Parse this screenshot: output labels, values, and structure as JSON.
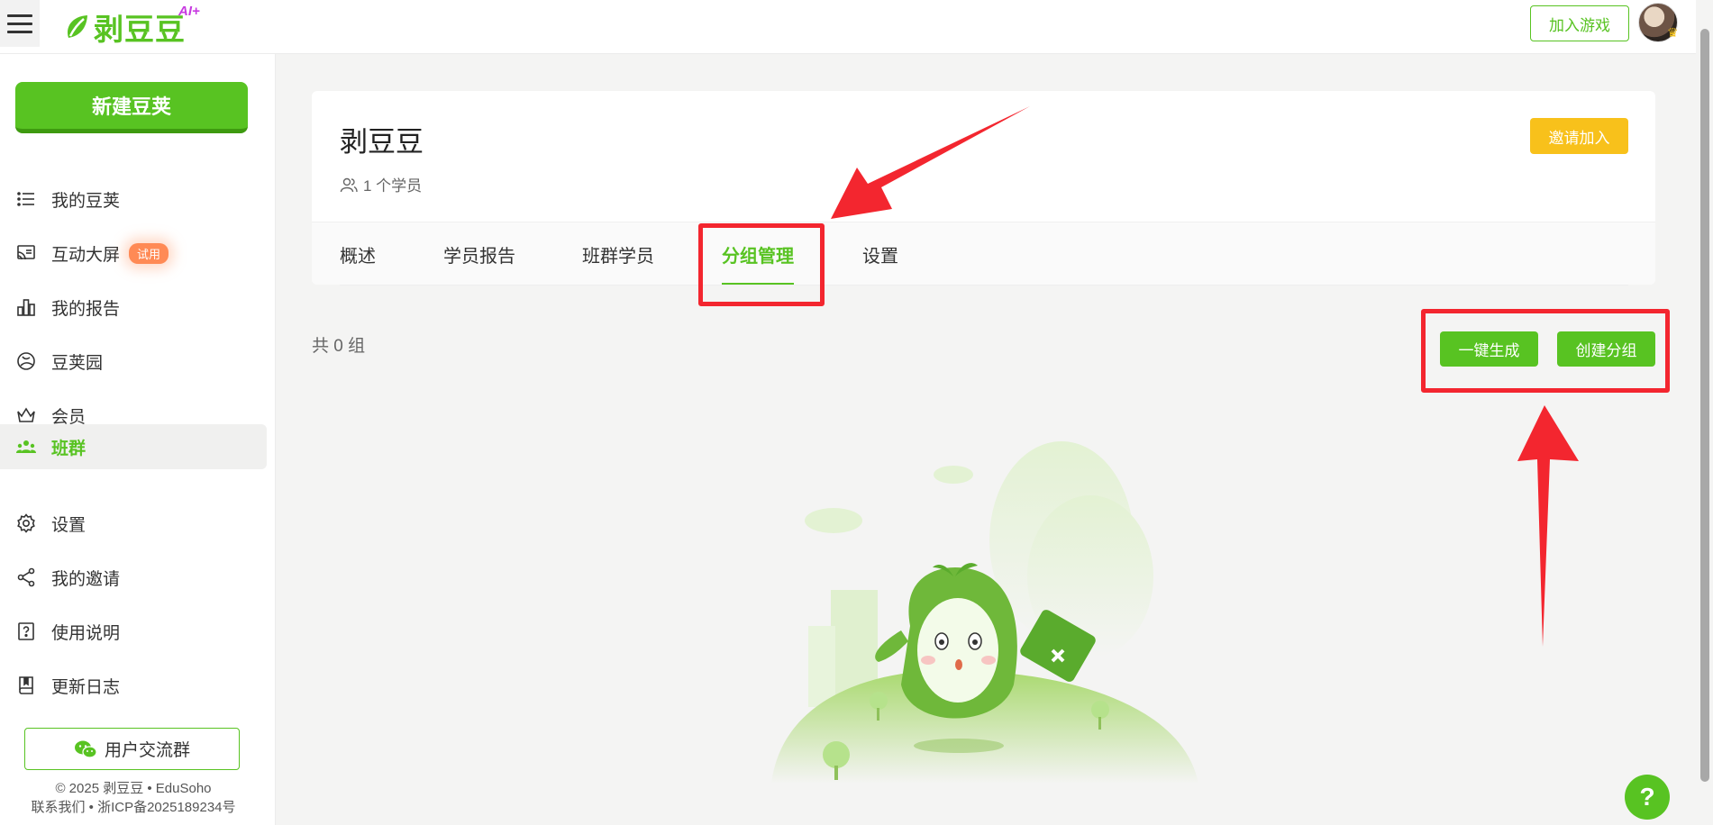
{
  "header": {
    "logo_text": "剥豆豆",
    "logo_badge": "AI+",
    "join_game_label": "加入游戏",
    "brand_color": "#58c322"
  },
  "sidebar": {
    "new_button_label": "新建豆荚",
    "items": [
      {
        "label": "我的豆荚",
        "icon": "list-icon",
        "active": false
      },
      {
        "label": "互动大屏",
        "icon": "cast-screen-icon",
        "badge": "试用",
        "active": false
      },
      {
        "label": "我的报告",
        "icon": "bar-chart-icon",
        "active": false
      },
      {
        "label": "豆荚园",
        "icon": "garden-icon",
        "active": false
      },
      {
        "label": "会员",
        "icon": "crown-icon",
        "active": false
      },
      {
        "label": "班群",
        "icon": "group-icon",
        "active": true
      },
      {
        "label": "设置",
        "icon": "gear-icon",
        "active": false
      },
      {
        "label": "我的邀请",
        "icon": "share-icon",
        "active": false
      },
      {
        "label": "使用说明",
        "icon": "help-doc-icon",
        "active": false
      },
      {
        "label": "更新日志",
        "icon": "book-icon",
        "active": false
      }
    ],
    "community_label": "用户交流群",
    "copyright": "© 2025 剥豆豆 • EduSoho",
    "icp": "联系我们 • 浙ICP备2025189234号"
  },
  "class_card": {
    "title": "剥豆豆",
    "members": "1 个学员",
    "invite_label": "邀请加入",
    "tabs": [
      {
        "label": "概述",
        "active": false
      },
      {
        "label": "学员报告",
        "active": false
      },
      {
        "label": "班群学员",
        "active": false
      },
      {
        "label": "分组管理",
        "active": true
      },
      {
        "label": "设置",
        "active": false
      }
    ]
  },
  "groups": {
    "count_text": "共 0 组",
    "auto_generate_label": "一键生成",
    "create_group_label": "创建分组"
  },
  "annotation_color": "#f3262f",
  "help_label": "?"
}
